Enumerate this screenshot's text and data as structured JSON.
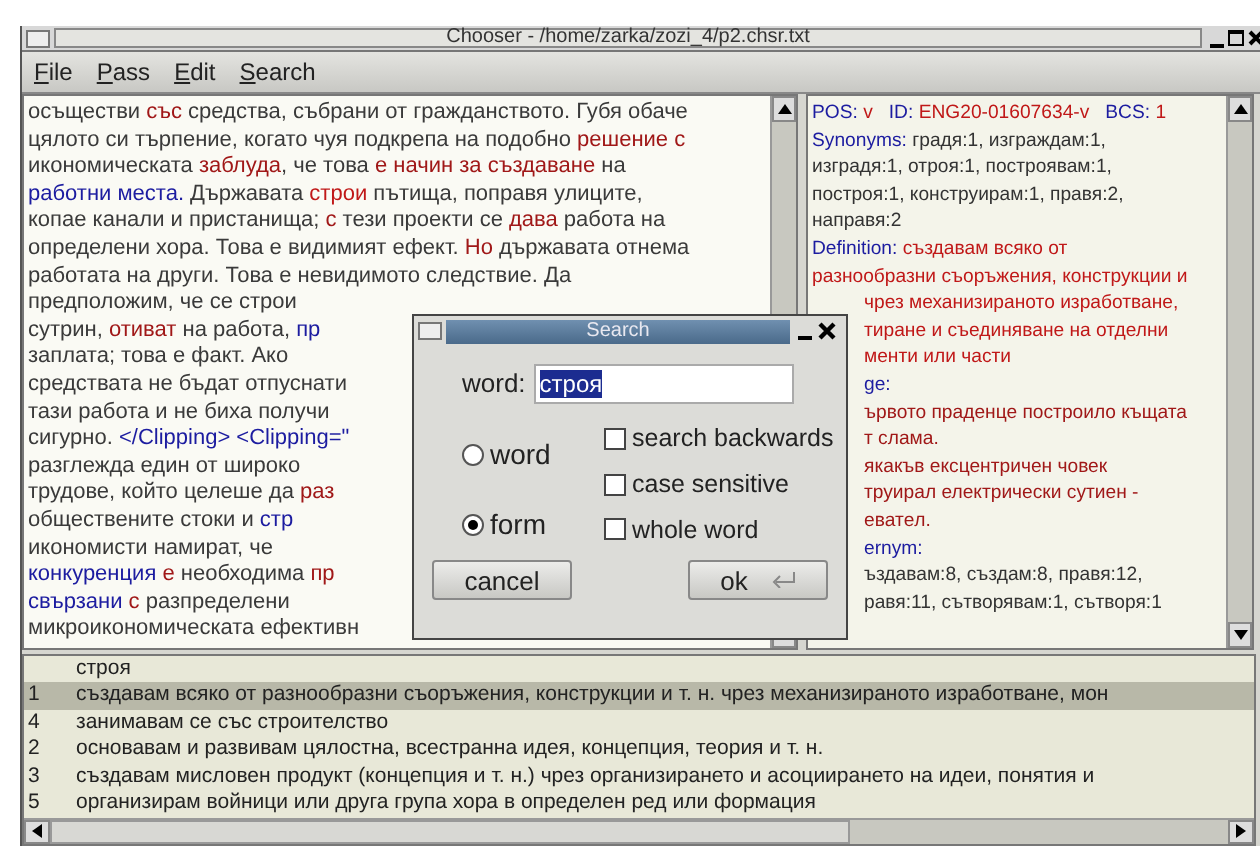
{
  "window": {
    "title": "Chooser - /home/zarka/zozi_4/p2.chsr.txt"
  },
  "menu": [
    "File",
    "Pass",
    "Edit",
    "Search"
  ],
  "text_panel": {
    "lines": [
      [
        {
          "t": "осъществи "
        },
        {
          "t": "със",
          "color": "#a01818"
        },
        {
          "t": " средства, събрани от гражданството. Губя обаче"
        }
      ],
      [
        {
          "t": "цялото си търпение, когато чуя подкрепа на подобно "
        },
        {
          "t": "решение с",
          "color": "#a01818"
        }
      ],
      [
        {
          "t": "икономическата "
        },
        {
          "t": "заблуда",
          "color": "#a01818"
        },
        {
          "t": ", че това "
        },
        {
          "t": "е начин за създаване",
          "color": "#a01818"
        },
        {
          "t": " на"
        }
      ],
      [
        {
          "t": "работни места.",
          "color": "#1c1ca0"
        },
        {
          "t": " Държавата "
        },
        {
          "t": "строи",
          "color": "#c01818"
        },
        {
          "t": " пътища, поправя улиците,"
        }
      ],
      [
        {
          "t": "копае канали и пристанища; "
        },
        {
          "t": "с",
          "color": "#a01818"
        },
        {
          "t": " тези проекти се "
        },
        {
          "t": "дава",
          "color": "#a01818"
        },
        {
          "t": " работа на"
        }
      ],
      [
        {
          "t": "определени хора. Това е видимият ефект. "
        },
        {
          "t": "Но",
          "color": "#a01818"
        },
        {
          "t": " държавата отнема"
        }
      ],
      [
        {
          "t": "работата на други. Това е невидимото следствие. Да"
        }
      ],
      [
        {
          "t": "предположим, че се строи"
        }
      ],
      [
        {
          "t": "сутрин, "
        },
        {
          "t": "отиват",
          "color": "#a01818"
        },
        {
          "t": " на работа, "
        },
        {
          "t": "пр",
          "color": "#1c1ca0"
        }
      ],
      [
        {
          "t": "заплата; това е факт. Ако"
        }
      ],
      [
        {
          "t": "средствата не бъдат отпуснати"
        }
      ],
      [
        {
          "t": "тази работа и не биха получи"
        }
      ],
      [
        {
          "t": "сигурно. "
        },
        {
          "t": "</Clipping> <Clipping=\"",
          "color": "#1c1ca0"
        }
      ],
      [
        {
          "t": "разглежда един от широко"
        }
      ],
      [
        {
          "t": "трудове, който целеше да "
        },
        {
          "t": "раз",
          "color": "#a01818"
        }
      ],
      [
        {
          "t": "обществените стоки и "
        },
        {
          "t": "стр",
          "color": "#1c1ca0"
        }
      ],
      [
        {
          "t": "икономисти намират, че"
        }
      ],
      [
        {
          "t": "конкуренция ",
          "color": "#1c1ca0"
        },
        {
          "t": "е",
          "color": "#a01818"
        },
        {
          "t": " необходима "
        },
        {
          "t": "пр",
          "color": "#a01818"
        }
      ],
      [
        {
          "t": "свързани ",
          "color": "#1c1ca0"
        },
        {
          "t": "с",
          "color": "#a01818"
        },
        {
          "t": " разпределени"
        }
      ],
      [
        {
          "t": "микроикономическата ефективн"
        }
      ]
    ]
  },
  "info_panel": {
    "lines": [
      [
        {
          "t": "POS: ",
          "color": "#1c1ca0"
        },
        {
          "t": "v",
          "color": "#c01818"
        },
        {
          "t": "   ID: ",
          "color": "#1c1ca0"
        },
        {
          "t": "ENG20-01607634-v",
          "color": "#c01818"
        },
        {
          "t": "   BCS: ",
          "color": "#1c1ca0"
        },
        {
          "t": "1",
          "color": "#c01818"
        }
      ],
      [
        {
          "t": "Synonyms: ",
          "color": "#1c1ca0"
        },
        {
          "t": "градя:1, изграждам:1,"
        }
      ],
      [
        {
          "t": "изградя:1, отроя:1, построявам:1,"
        }
      ],
      [
        {
          "t": "построя:1, конструирам:1, правя:2,"
        }
      ],
      [
        {
          "t": "направя:2"
        }
      ],
      [
        {
          "t": "Definition: ",
          "color": "#1c1ca0"
        },
        {
          "t": "създавам всяко от",
          "color": "#c01818"
        }
      ],
      [
        {
          "t": "разнообразни съоръжения, конструкции и",
          "color": "#c01818"
        }
      ],
      [
        {
          "t": "чрез механизираното изработване,",
          "color": "#c01818"
        }
      ],
      [
        {
          "t": "тиране и съединяване на отделни",
          "color": "#c01818"
        }
      ],
      [
        {
          "t": "менти или части",
          "color": "#c01818"
        }
      ],
      [
        {
          "t": "ge:",
          "color": "#1c1ca0"
        }
      ],
      [
        {
          "t": "ървото праденце построило къщата",
          "color": "#a01818"
        }
      ],
      [
        {
          "t": "т слама.",
          "color": "#a01818"
        }
      ],
      [
        {
          "t": "якакъв ексцентричен човек",
          "color": "#a01818"
        }
      ],
      [
        {
          "t": "труирал електрически сутиен -",
          "color": "#a01818"
        }
      ],
      [
        {
          "t": "еватeл.",
          "color": "#a01818"
        }
      ],
      [
        {
          "t": "ernym:",
          "color": "#1c1ca0"
        }
      ],
      [
        {
          "t": "ъздавам:8, създам:8, правя:12,"
        }
      ],
      [
        {
          "t": "равя:11, сътворявам:1, сътворя:1"
        }
      ]
    ]
  },
  "senses": {
    "header": "строя",
    "rows": [
      {
        "number": "1",
        "text": "създавам всяко от разнообразни съоръжения, конструкции и т. н. чрез механизираното изработване, мон",
        "selected": true
      },
      {
        "number": "4",
        "text": "занимавам се със строителство",
        "selected": false
      },
      {
        "number": "2",
        "text": "основавам и развивам цялостна, всестранна идея, концепция, теория и т. н.",
        "selected": false
      },
      {
        "number": "3",
        "text": "създавам мисловен продукт (концепция и т. н.) чрез организирането и асоциирането на идеи, понятия и",
        "selected": false
      },
      {
        "number": "5",
        "text": "организирам войници или друга група хора в определен ред или формация",
        "selected": false
      }
    ]
  },
  "dialog": {
    "title": "Search",
    "word_label": "word:",
    "word_value": "строя",
    "modes": [
      {
        "label": "word",
        "selected": false
      },
      {
        "label": "form",
        "selected": true
      }
    ],
    "options": [
      {
        "label": "search backwards",
        "checked": false
      },
      {
        "label": "case sensitive",
        "checked": false
      },
      {
        "label": "whole word",
        "checked": false
      }
    ],
    "buttons": [
      {
        "label": "cancel",
        "kind": "cancel"
      },
      {
        "label": "ok",
        "kind": "ok"
      }
    ]
  }
}
